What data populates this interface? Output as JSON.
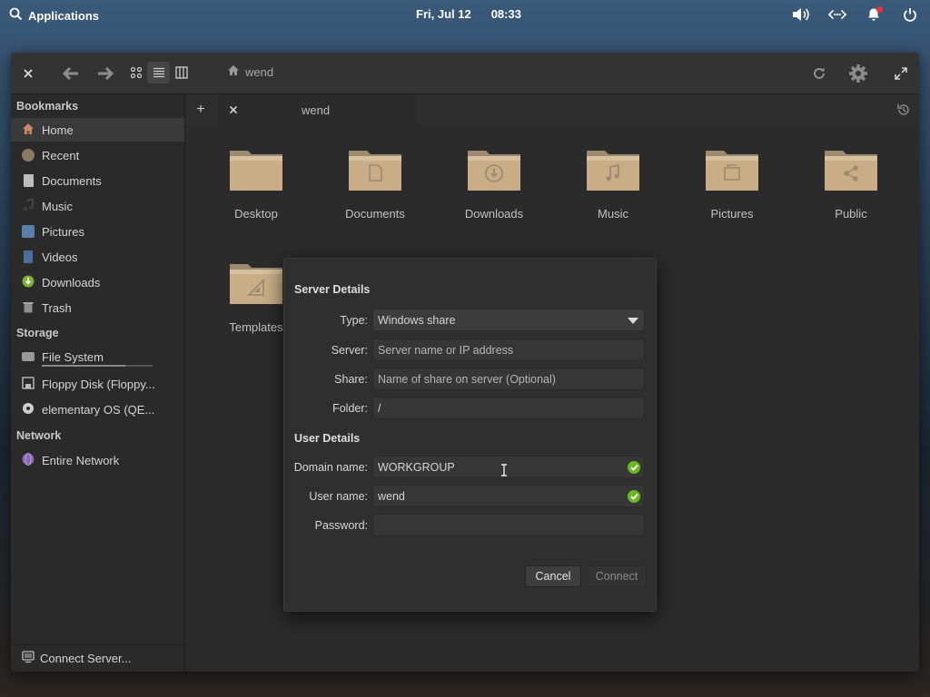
{
  "panel": {
    "applications_label": "Applications",
    "date": "Fri, Jul 12",
    "time": "08:33"
  },
  "window": {
    "location": "wend"
  },
  "sidebar": {
    "bookmarks_header": "Bookmarks",
    "bookmarks": [
      {
        "label": "Home",
        "icon": "home-icon"
      },
      {
        "label": "Recent",
        "icon": "recent-icon"
      },
      {
        "label": "Documents",
        "icon": "documents-icon"
      },
      {
        "label": "Music",
        "icon": "music-icon"
      },
      {
        "label": "Pictures",
        "icon": "pictures-icon"
      },
      {
        "label": "Videos",
        "icon": "videos-icon"
      },
      {
        "label": "Downloads",
        "icon": "downloads-icon"
      },
      {
        "label": "Trash",
        "icon": "trash-icon"
      }
    ],
    "storage_header": "Storage",
    "storage": [
      {
        "label": "File System"
      },
      {
        "label": "Floppy Disk (Floppy..."
      },
      {
        "label": "elementary OS (QE..."
      }
    ],
    "network_header": "Network",
    "network": [
      {
        "label": "Entire Network"
      }
    ],
    "connect_server_label": "Connect Server..."
  },
  "tabs": {
    "active_title": "wend"
  },
  "folders": [
    {
      "label": "Desktop",
      "icon": "folder-icon"
    },
    {
      "label": "Documents",
      "icon": "folder-documents-icon"
    },
    {
      "label": "Downloads",
      "icon": "folder-downloads-icon"
    },
    {
      "label": "Music",
      "icon": "folder-music-icon"
    },
    {
      "label": "Pictures",
      "icon": "folder-pictures-icon"
    },
    {
      "label": "Public",
      "icon": "folder-public-icon"
    },
    {
      "label": "Templates",
      "icon": "folder-templates-icon"
    }
  ],
  "dialog": {
    "server_details_header": "Server Details",
    "type_label": "Type:",
    "type_value": "Windows share",
    "server_label": "Server:",
    "server_placeholder": "Server name or IP address",
    "share_label": "Share:",
    "share_placeholder": "Name of share on server (Optional)",
    "folder_label": "Folder:",
    "folder_value": "/",
    "user_details_header": "User Details",
    "domain_label": "Domain name:",
    "domain_value": "WORKGROUP",
    "username_label": "User name:",
    "username_value": "wend",
    "password_label": "Password:",
    "password_value": "",
    "cancel_label": "Cancel",
    "connect_label": "Connect"
  },
  "colors": {
    "accent_folder": "#c9ad87",
    "valid_check": "#68b723",
    "notification": "#e8333d"
  }
}
